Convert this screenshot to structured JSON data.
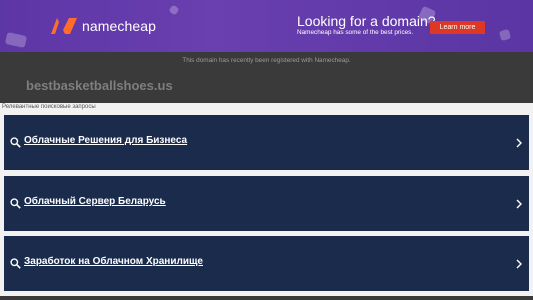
{
  "banner": {
    "logo_text": "namecheap",
    "headline": "Looking for a domain?",
    "subline": "Namecheap has some of the best prices.",
    "button_label": "Learn more",
    "colors": {
      "background": "#5d36a6",
      "button": "#de3723",
      "logo_mark": "#ff6c2c"
    }
  },
  "header": {
    "notice": "This domain has recently been registered with Namecheap.",
    "domain": "bestbasketballshoes.us"
  },
  "related_label": "Релевантные поисковые запросы",
  "results": [
    {
      "label": "Облачные Решения для Бизнеса"
    },
    {
      "label": "Облачный Сервер Беларусь"
    },
    {
      "label": "Заработок на Облачном Хранилище"
    }
  ],
  "colors": {
    "card": "#1b2b4c",
    "dark_header": "#3a3a3a"
  },
  "icons": {
    "search": "search-icon",
    "chevron": "chevron-right-icon"
  }
}
